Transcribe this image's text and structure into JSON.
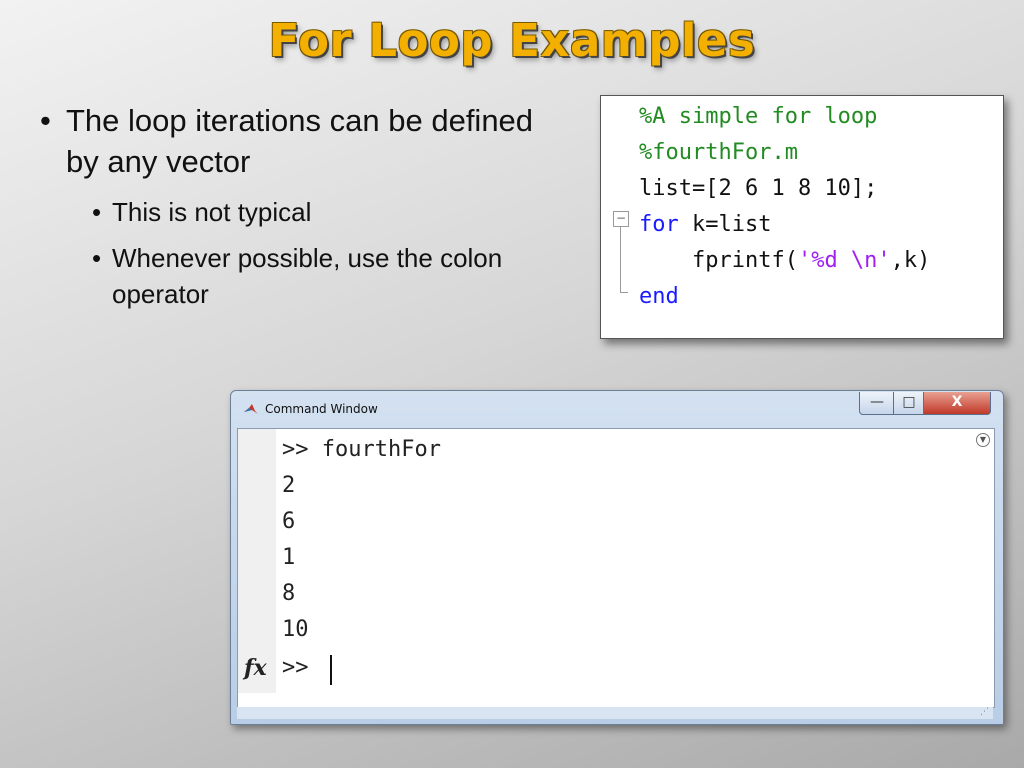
{
  "slide": {
    "title": "For Loop Examples",
    "bullets": [
      {
        "text": "The loop iterations can be defined by any vector",
        "children": [
          "This is not typical",
          "Whenever possible, use the colon operator"
        ]
      }
    ]
  },
  "editor": {
    "lines": [
      {
        "parts": [
          {
            "text": "%A simple for loop",
            "color": "green"
          }
        ]
      },
      {
        "parts": [
          {
            "text": "%fourthFor.m",
            "color": "green"
          }
        ]
      },
      {
        "parts": [
          {
            "text": "list=[2 6 1 8 10];",
            "color": "black"
          }
        ]
      },
      {
        "parts": [
          {
            "text": "for",
            "color": "blue"
          },
          {
            "text": " k=list",
            "color": "black"
          }
        ]
      },
      {
        "parts": [
          {
            "text": "    fprintf(",
            "color": "black"
          },
          {
            "text": "'%d \\n'",
            "color": "purple"
          },
          {
            "text": ",k)",
            "color": "black"
          }
        ]
      },
      {
        "parts": [
          {
            "text": "end",
            "color": "blue"
          }
        ]
      }
    ],
    "fold_icon": "minus-box-icon"
  },
  "command_window": {
    "title": "Command Window",
    "buttons": {
      "minimize": "—",
      "maximize": "□",
      "close": "X"
    },
    "lines": [
      ">> fourthFor",
      "2",
      "6",
      "1",
      "8",
      "10"
    ],
    "prompt": ">>",
    "fx_label": "fx",
    "colors": {
      "titlebar": "#c6d5ea",
      "close": "#c0392b"
    }
  }
}
